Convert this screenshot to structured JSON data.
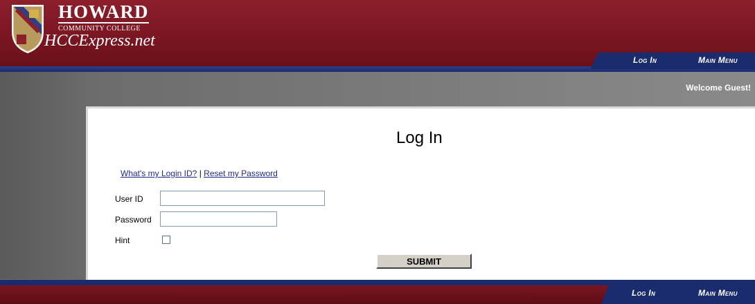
{
  "logo": {
    "college_name": "HOWARD",
    "college_subtitle": "COMMUNITY COLLEGE",
    "portal_name": "HCCExpress.net"
  },
  "top_nav": {
    "login_label": "Log In",
    "main_menu_label": "Main Menu"
  },
  "welcome": {
    "text": "Welcome Guest!"
  },
  "login": {
    "title": "Log In",
    "help_login_id": "What's my Login ID?",
    "separator": "|",
    "help_reset": "Reset my Password",
    "user_id_label": "User ID",
    "user_id_value": "",
    "password_label": "Password",
    "password_value": "",
    "hint_label": "Hint",
    "hint_checked": false,
    "submit_label": "SUBMIT"
  },
  "bottom_nav": {
    "login_label": "Log In",
    "main_menu_label": "Main Menu"
  },
  "colors": {
    "header_red": "#7a1622",
    "nav_blue": "#1b2c6e",
    "link_blue": "#1f2a8a",
    "background_gray": "#6e6e6e"
  }
}
